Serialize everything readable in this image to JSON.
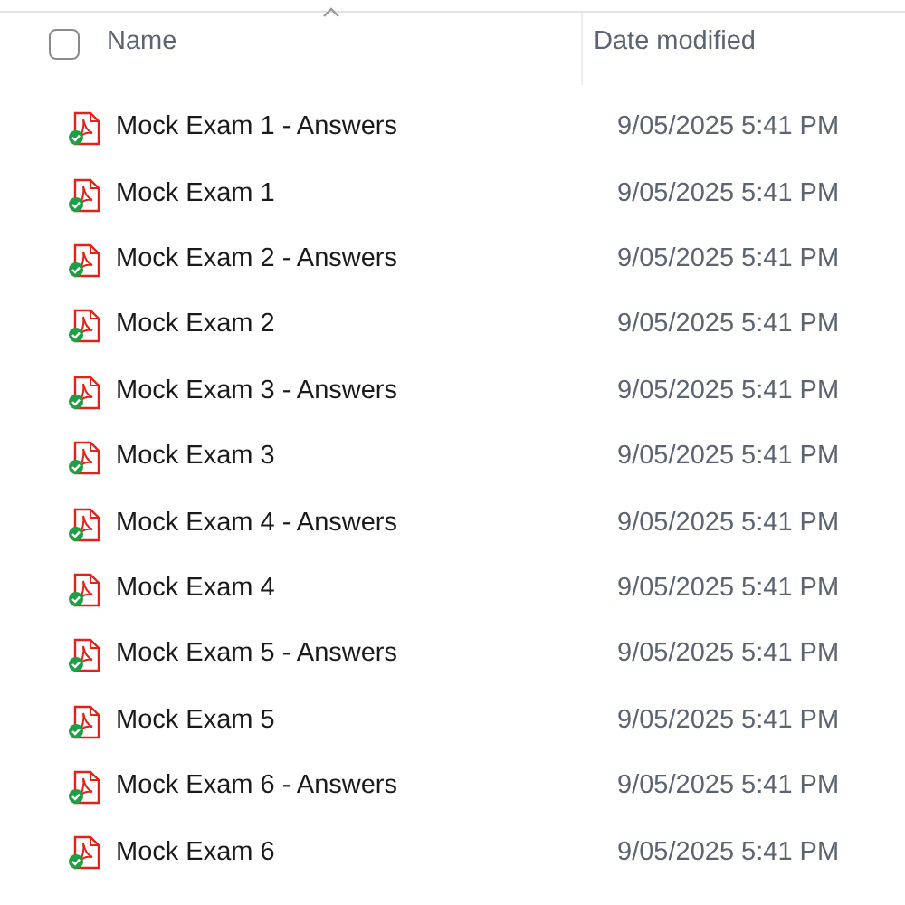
{
  "header": {
    "select_all": {
      "checked": false
    },
    "columns": [
      "Name",
      "Date modified"
    ]
  },
  "files": [
    {
      "name": "Mock Exam 1 - Answers",
      "date": "9/05/2025 5:41 PM",
      "synced": true
    },
    {
      "name": "Mock Exam 1",
      "date": "9/05/2025 5:41 PM",
      "synced": true
    },
    {
      "name": "Mock Exam 2 - Answers",
      "date": "9/05/2025 5:41 PM",
      "synced": true
    },
    {
      "name": "Mock Exam 2",
      "date": "9/05/2025 5:41 PM",
      "synced": true
    },
    {
      "name": "Mock Exam 3 - Answers",
      "date": "9/05/2025 5:41 PM",
      "synced": true
    },
    {
      "name": "Mock Exam 3",
      "date": "9/05/2025 5:41 PM",
      "synced": true
    },
    {
      "name": "Mock Exam 4 - Answers",
      "date": "9/05/2025 5:41 PM",
      "synced": true
    },
    {
      "name": "Mock Exam 4",
      "date": "9/05/2025 5:41 PM",
      "synced": true
    },
    {
      "name": "Mock Exam 5 - Answers",
      "date": "9/05/2025 5:41 PM",
      "synced": true
    },
    {
      "name": "Mock Exam 5",
      "date": "9/05/2025 5:41 PM",
      "synced": true
    },
    {
      "name": "Mock Exam 6 - Answers",
      "date": "9/05/2025 5:41 PM",
      "synced": true
    },
    {
      "name": "Mock Exam 6",
      "date": "9/05/2025 5:41 PM",
      "synced": true
    }
  ]
}
